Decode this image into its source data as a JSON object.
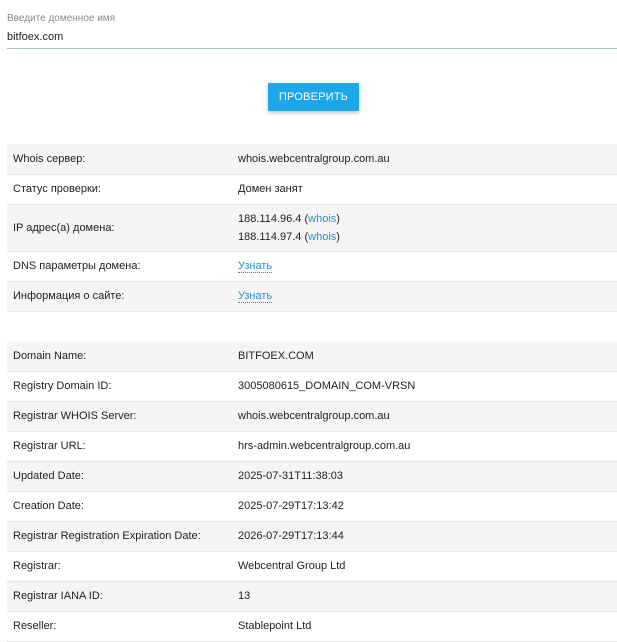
{
  "domain_input": {
    "label": "Введите доменное имя",
    "value": "bitfoex.com"
  },
  "check_button": "ПРОВЕРИТЬ",
  "summary": {
    "whois_server_label": "Whois сервер:",
    "whois_server_value": "whois.webcentralgroup.com.au",
    "status_label": "Статус проверки:",
    "status_value": "Домен занят",
    "ip_label": "IP адрес(а) домена:",
    "ip1": "188.114.96.4",
    "ip2": "188.114.97.4",
    "whois_link": "whois",
    "dns_label": "DNS параметры домена:",
    "dns_link": "Узнать",
    "site_label": "Информация о сайте:",
    "site_link": "Узнать"
  },
  "whois": [
    {
      "key": "Domain Name:",
      "value": "BITFOEX.COM"
    },
    {
      "key": "Registry Domain ID:",
      "value": "3005080615_DOMAIN_COM-VRSN"
    },
    {
      "key": "Registrar WHOIS Server:",
      "value": "whois.webcentralgroup.com.au"
    },
    {
      "key": "Registrar URL:",
      "value": "hrs-admin.webcentralgroup.com.au"
    },
    {
      "key": "Updated Date:",
      "value": "2025-07-31T11:38:03"
    },
    {
      "key": "Creation Date:",
      "value": "2025-07-29T17:13:42"
    },
    {
      "key": "Registrar Registration Expiration Date:",
      "value": "2026-07-29T17:13:44"
    },
    {
      "key": "Registrar:",
      "value": "Webcentral Group Ltd"
    },
    {
      "key": "Registrar IANA ID:",
      "value": "13"
    },
    {
      "key": "Reseller:",
      "value": "Stablepoint Ltd"
    }
  ]
}
